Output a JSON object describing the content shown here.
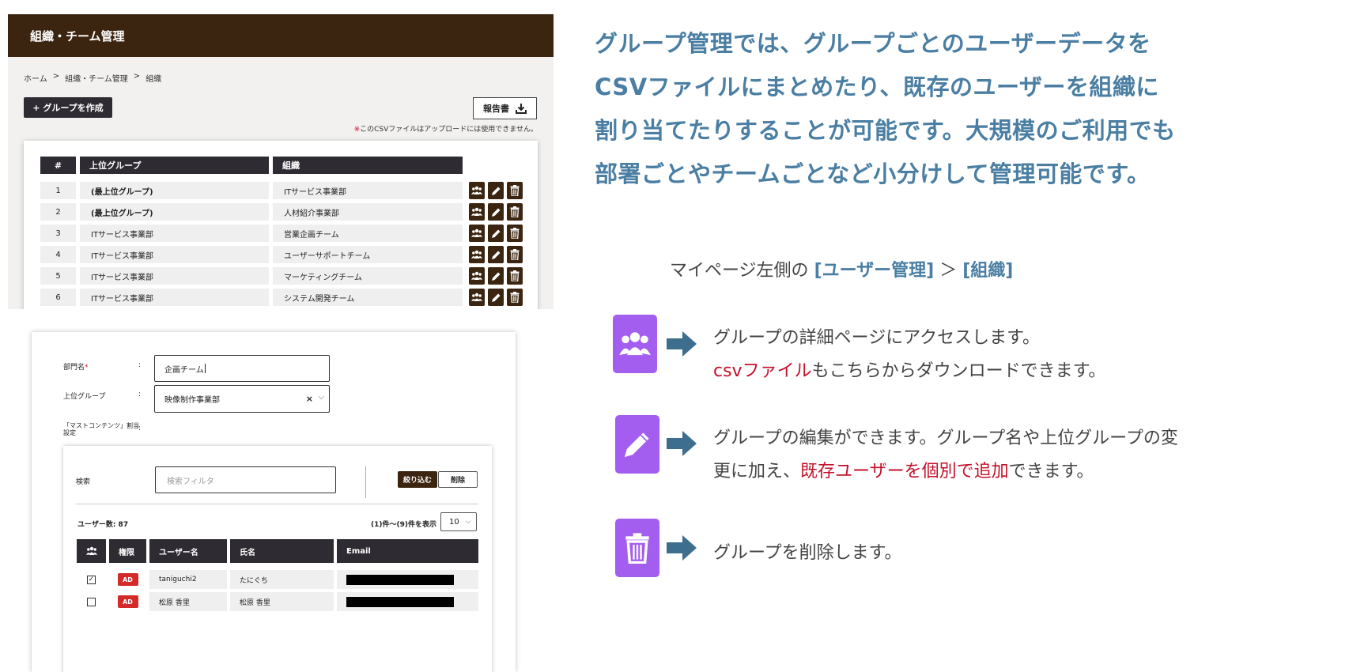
{
  "admin_list": {
    "header_title": "組織・チーム管理",
    "breadcrumb": [
      "ホーム",
      ">",
      "組織・チーム管理",
      ">",
      "組織"
    ],
    "create_button": "+ グループを作成",
    "report_button": "報告書",
    "csv_note_mark": "※",
    "csv_note": "このCSVファイルはアップロードには使用できません。",
    "columns": [
      "#",
      "上位グループ",
      "組織"
    ],
    "rows": [
      {
        "num": "1",
        "parent": "(最上位グループ)",
        "org": "ITサービス事業部"
      },
      {
        "num": "2",
        "parent": "(最上位グループ)",
        "org": "人材紹介事業部"
      },
      {
        "num": "3",
        "parent": "ITサービス事業部",
        "org": "営業企画チーム"
      },
      {
        "num": "4",
        "parent": "ITサービス事業部",
        "org": "ユーザーサポートチーム"
      },
      {
        "num": "5",
        "parent": "ITサービス事業部",
        "org": "マーケティングチーム"
      },
      {
        "num": "6",
        "parent": "ITサービス事業部",
        "org": "システム開発チーム"
      }
    ]
  },
  "edit_form": {
    "dept_label": "部門名",
    "dept_required": "*",
    "dept_value": "企画チーム",
    "parent_label": "上位グループ",
    "parent_value": "映像制作事業部",
    "assign_label_1": "「マストコンテンツ」割当",
    "assign_label_2": "設定",
    "colon": ":",
    "search_label": "検索",
    "search_placeholder": "検索フィルタ",
    "filter_button": "絞り込む",
    "delete_button": "削除",
    "user_count": "ユーザー数: 87",
    "range_text": "(1)件〜(9)件を表示",
    "per_page": "10",
    "columns": [
      "権限",
      "ユーザー名",
      "氏名",
      "Email"
    ],
    "users": [
      {
        "checked": true,
        "role": "AD",
        "username": "taniguchi2",
        "name": "たにぐち"
      },
      {
        "checked": false,
        "role": "AD",
        "username": "松原 香里",
        "name": "松原 香里"
      }
    ]
  },
  "explanation": {
    "headline": [
      "グループ管理では、グループごとのユーザーデータを",
      "CSVファイルにまとめたり、既存のユーザーを組織に",
      "割り当てたりすることが可能です。大規模のご利用でも",
      "部署ごとやチームごとなど小分けして管理可能です。"
    ],
    "nav_prefix": "マイページ左側の ",
    "nav_item1": "[ユーザー管理]",
    "nav_sep": " ＞ ",
    "nav_item2": "[組織]",
    "feature1_line1": "グループの詳細ページにアクセスします。",
    "feature1_red": "csvファイル",
    "feature1_rest": "もこちらからダウンロードできます。",
    "feature2_line1": "グループの編集ができます。グループ名や上位グループの変",
    "feature2_pre": "更に加え、",
    "feature2_red": "既存ユーザーを個別で追加",
    "feature2_post": "できます。",
    "feature3_line1": "グループを削除します。"
  },
  "colors": {
    "header_brown": "#3b2410",
    "headline_blue": "#4a7ea3",
    "icon_purple": "#a35ef0",
    "arrow_blue": "#3d6e8e",
    "accent_red": "#c4102a"
  }
}
